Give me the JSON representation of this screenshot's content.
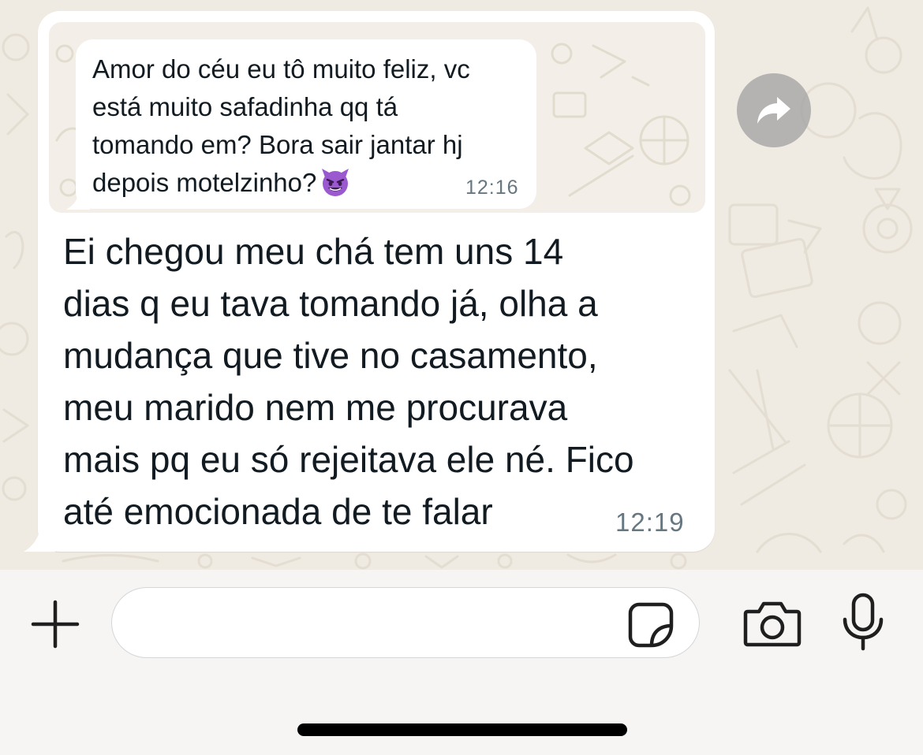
{
  "colors": {
    "chat_background": "#efeae2",
    "bubble": "#ffffff",
    "quote_box": "#f3efe8",
    "text": "#111b21",
    "timestamp": "#667781",
    "input_bar": "#f6f5f3"
  },
  "quoted_message": {
    "text": "Amor do céu eu tô muito feliz, vc\nestá muito safadinha qq tá\ntomando em? Bora sair jantar hj\ndepois motelzinho?",
    "emoji": "smiling-imp-emoji",
    "time": "12:16"
  },
  "message": {
    "text": "Ei chegou meu chá tem uns 14\ndias q eu tava tomando já, olha a\nmudança que tive no casamento,\nmeu marido nem me procurava\nmais pq eu só rejeitava ele né. Fico\naté emocionada de te falar",
    "time": "12:19"
  },
  "composer": {
    "input_value": "",
    "input_placeholder": ""
  },
  "icons": {
    "forward": "forward-icon",
    "plus": "plus-icon",
    "sticker": "sticker-icon",
    "camera": "camera-icon",
    "mic": "microphone-icon"
  }
}
